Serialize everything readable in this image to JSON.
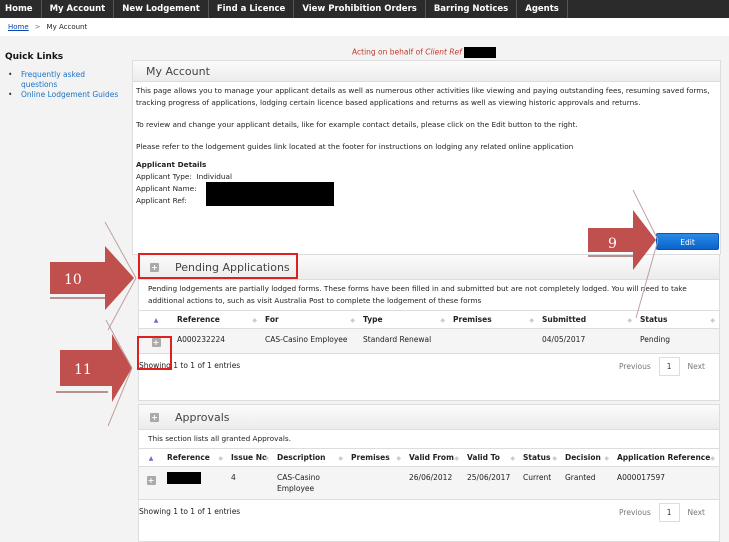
{
  "nav": {
    "items": [
      "Home",
      "My Account",
      "New Lodgement",
      "Find a Licence",
      "View Prohibition Orders",
      "Barring Notices",
      "Agents"
    ]
  },
  "breadcrumb": {
    "home": "Home",
    "separator": ">",
    "current": "My Account"
  },
  "sidebar": {
    "title": "Quick Links",
    "links": [
      "Frequently asked questions",
      "Online Lodgement Guides"
    ]
  },
  "acting": {
    "prefix": "Acting on behalf of",
    "label": "Client Ref"
  },
  "account": {
    "title": "My Account",
    "intro": "This page allows you to manage your applicant details as well as numerous other activities like viewing and paying outstanding fees, resuming saved forms, tracking progress of applications, lodging certain licence based applications and returns as well as viewing historic approvals and returns.",
    "review": "To review and change your applicant details, like for example contact details, please click on the Edit button to the right.",
    "guides": "Please refer to the lodgement guides link located at the footer for instructions on lodging any related online application",
    "details_title": "Applicant Details",
    "type_label": "Applicant Type:",
    "type_value": "Individual",
    "name_label": "Applicant Name:",
    "ref_label": "Applicant Ref:",
    "edit_label": "Edit"
  },
  "pending": {
    "title": "Pending Applications",
    "description": "Pending lodgements are partially lodged forms. These forms have been filled in and submitted but are not completely lodged. You will need to take additional actions to, such as visit Australia Post to complete the lodgement of these forms",
    "columns": [
      "Reference",
      "For",
      "Type",
      "Premises",
      "Submitted",
      "Status"
    ],
    "rows": [
      {
        "reference": "A000232224",
        "for": "CAS-Casino Employee",
        "type": "Standard Renewal",
        "premises": "",
        "submitted": "04/05/2017",
        "status": "Pending"
      }
    ],
    "showing": "Showing 1 to 1 of 1 entries",
    "previous": "Previous",
    "page": "1",
    "next": "Next"
  },
  "approvals": {
    "title": "Approvals",
    "description": "This section lists all granted Approvals.",
    "columns": [
      "Reference",
      "Issue No",
      "Description",
      "Premises",
      "Valid From",
      "Valid To",
      "Status",
      "Decision",
      "Application Reference"
    ],
    "rows": [
      {
        "issue_no": "4",
        "description": "CAS-Casino Employee",
        "premises": "",
        "valid_from": "26/06/2012",
        "valid_to": "25/06/2017",
        "status": "Current",
        "decision": "Granted",
        "app_ref": "A000017597"
      }
    ],
    "showing": "Showing 1 to 1 of 1 entries",
    "previous": "Previous",
    "page": "1",
    "next": "Next"
  },
  "callouts": [
    "9",
    "10",
    "11"
  ],
  "colors": {
    "callout": "#c0504d",
    "highlight": "#e02020",
    "edit_button": "#1670d8",
    "acting_text": "#c0392b"
  }
}
